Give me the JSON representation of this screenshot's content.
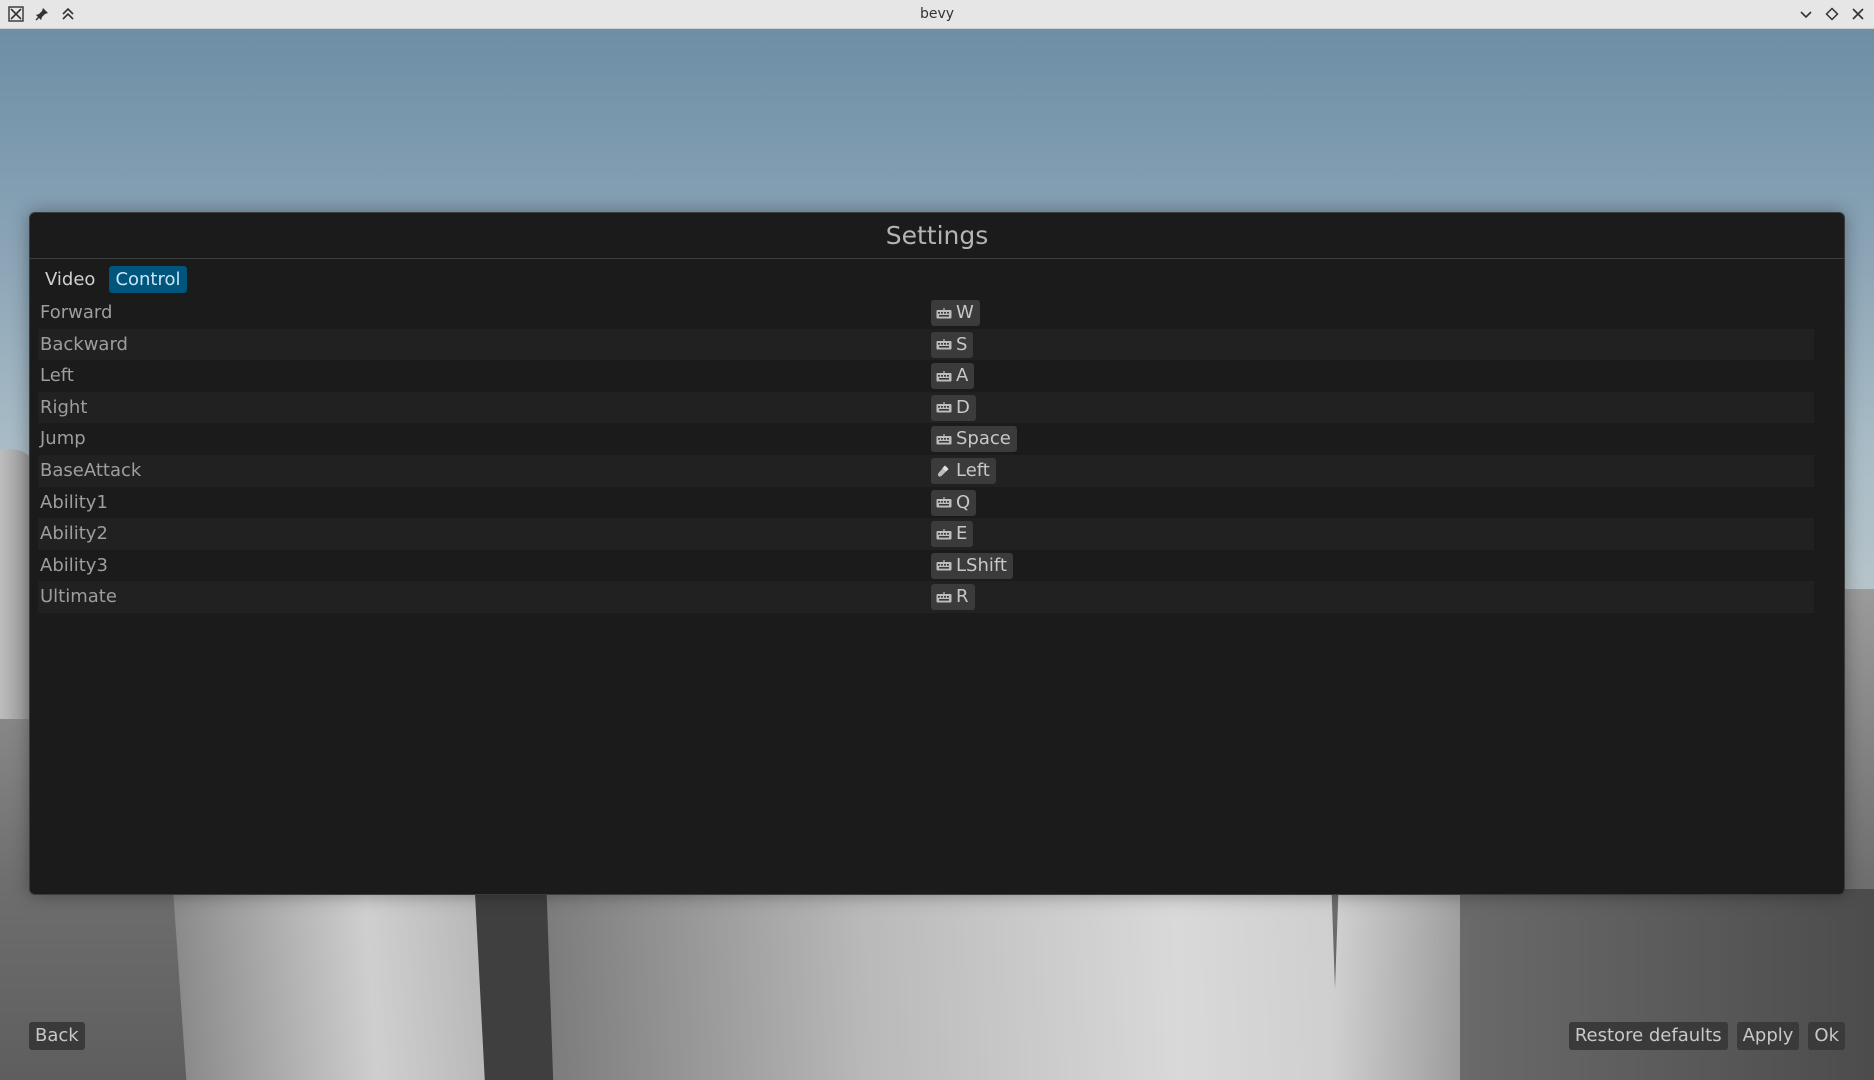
{
  "window": {
    "title": "bevy",
    "left_icons": [
      "close-x-icon",
      "pin-icon",
      "keep-above-icon"
    ],
    "right_icons": [
      "minimize-icon",
      "maximize-icon",
      "close-icon"
    ]
  },
  "settings": {
    "title": "Settings",
    "tabs": [
      {
        "label": "Video",
        "active": false
      },
      {
        "label": "Control",
        "active": true
      }
    ],
    "bindings": [
      {
        "action": "Forward",
        "device": "keyboard-icon",
        "key": "W"
      },
      {
        "action": "Backward",
        "device": "keyboard-icon",
        "key": "S"
      },
      {
        "action": "Left",
        "device": "keyboard-icon",
        "key": "A"
      },
      {
        "action": "Right",
        "device": "keyboard-icon",
        "key": "D"
      },
      {
        "action": "Jump",
        "device": "keyboard-icon",
        "key": "Space"
      },
      {
        "action": "BaseAttack",
        "device": "mouse-icon",
        "key": "Left"
      },
      {
        "action": "Ability1",
        "device": "keyboard-icon",
        "key": "Q"
      },
      {
        "action": "Ability2",
        "device": "keyboard-icon",
        "key": "E"
      },
      {
        "action": "Ability3",
        "device": "keyboard-icon",
        "key": "LShift"
      },
      {
        "action": "Ultimate",
        "device": "keyboard-icon",
        "key": "R"
      }
    ]
  },
  "footer": {
    "back": "Back",
    "restore_defaults": "Restore defaults",
    "apply": "Apply",
    "ok": "Ok"
  },
  "colors": {
    "panel_bg": "#1b1b1b",
    "active_tab_bg": "#00557c",
    "button_bg": "#3a3a3a"
  }
}
